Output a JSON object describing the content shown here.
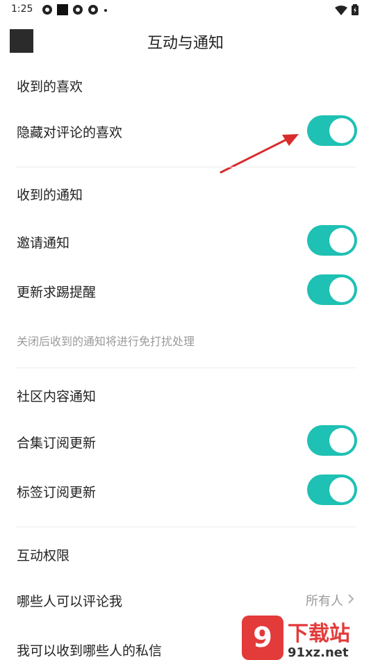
{
  "status_bar": {
    "time": "1:25"
  },
  "header": {
    "title": "互动与通知"
  },
  "sections": {
    "likes": {
      "title": "收到的喜欢",
      "hide_comment_likes": {
        "label": "隐藏对评论的喜欢",
        "on": true
      }
    },
    "notifications": {
      "title": "收到的通知",
      "invite": {
        "label": "邀请通知",
        "on": true
      },
      "update_reminder": {
        "label": "更新求踢提醒",
        "on": true
      },
      "hint": "关闭后收到的通知将进行免打扰处理"
    },
    "community": {
      "title": "社区内容通知",
      "collection": {
        "label": "合集订阅更新",
        "on": true
      },
      "tag": {
        "label": "标签订阅更新",
        "on": true
      }
    },
    "permissions": {
      "title": "互动权限",
      "who_can_comment": {
        "label": "哪些人可以评论我",
        "value": "所有人"
      },
      "who_can_message": {
        "label": "我可以收到哪些人的私信"
      }
    }
  },
  "watermark": {
    "badge": "9",
    "cn": "下载站",
    "url": "91xz.net"
  },
  "colors": {
    "toggle_on": "#1ec1b3",
    "arrow": "#d92b2b",
    "watermark": "#e33a3a"
  }
}
